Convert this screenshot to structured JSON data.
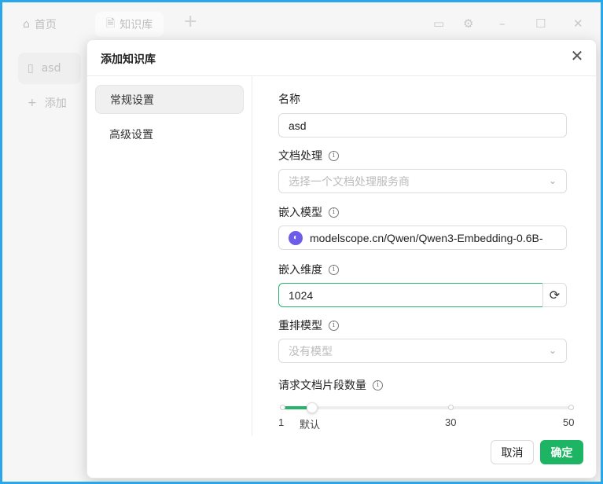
{
  "topbar": {
    "home_label": "首页",
    "kb_tab_label": "知识库",
    "add_tab": "+"
  },
  "sidebar": {
    "items": [
      {
        "label": "asd"
      },
      {
        "label": "添加"
      }
    ]
  },
  "modal": {
    "title": "添加知识库",
    "nav": [
      {
        "label": "常规设置",
        "active": true
      },
      {
        "label": "高级设置",
        "active": false
      }
    ],
    "fields": {
      "name_label": "名称",
      "name_value": "asd",
      "doc_processing_label": "文档处理",
      "doc_processing_placeholder": "选择一个文档处理服务商",
      "embed_model_label": "嵌入模型",
      "embed_model_value": "modelscope.cn/Qwen/Qwen3-Embedding-0.6B-",
      "embed_dim_label": "嵌入维度",
      "embed_dim_value": "1024",
      "rerank_label": "重排模型",
      "rerank_placeholder": "没有模型",
      "chunk_count_label": "请求文档片段数量"
    },
    "slider": {
      "min_label": "1",
      "default_label": "默认",
      "mid_label": "30",
      "max_label": "50",
      "min": 1,
      "max": 50,
      "value": 6
    },
    "buttons": {
      "cancel": "取消",
      "ok": "确定"
    }
  },
  "colors": {
    "accent": "#1db463",
    "frame": "#2aa7e8"
  }
}
